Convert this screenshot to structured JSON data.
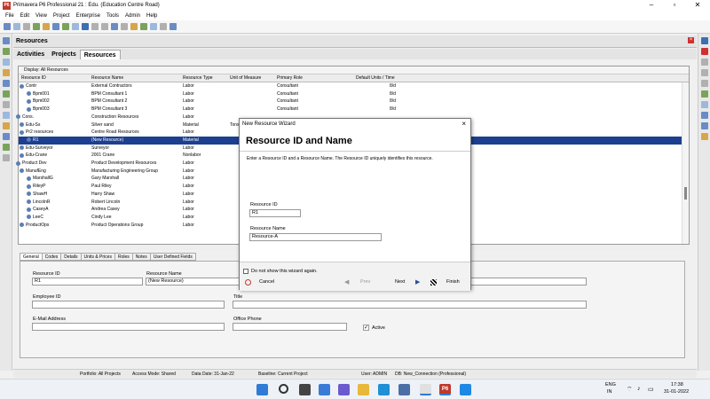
{
  "window": {
    "title": "Primavera P6 Professional 21 : Edu. (Education Centre Road)",
    "logo": "P6"
  },
  "menu": [
    "File",
    "Edit",
    "View",
    "Project",
    "Enterprise",
    "Tools",
    "Admin",
    "Help"
  ],
  "module": {
    "title": "Resources"
  },
  "tabs": [
    "Activities",
    "Projects",
    "Resources"
  ],
  "grid": {
    "display": "Display: All Resources",
    "columns": [
      "Resource ID",
      "Resource Name",
      "Resource Type",
      "Unit of Measure",
      "Primary Role",
      "Default Units / Time"
    ],
    "rows": [
      {
        "id": "Contr",
        "name": "External Contractors",
        "type": "Labor",
        "uom": "",
        "role": "Consultant",
        "units": "8/d"
      },
      {
        "id": "Bpm001",
        "name": "BPM Consultant 1",
        "type": "Labor",
        "uom": "",
        "role": "Consultant",
        "units": "8/d"
      },
      {
        "id": "Bpm002",
        "name": "BPM Consultant 2",
        "type": "Labor",
        "uom": "",
        "role": "Consultant",
        "units": "8/d"
      },
      {
        "id": "Bpm003",
        "name": "BPM Consultant 3",
        "type": "Labor",
        "uom": "",
        "role": "Consultant",
        "units": "8/d"
      },
      {
        "id": "Cons.",
        "name": "Construction Resources",
        "type": "Labor",
        "uom": "",
        "role": "",
        "units": ""
      },
      {
        "id": "Edu-Ss",
        "name": "Silver sand",
        "type": "Material",
        "uom": "Tons",
        "role": "",
        "units": ""
      },
      {
        "id": "Pr2 resources",
        "name": "Centre Road Resources",
        "type": "Labor",
        "uom": "",
        "role": "",
        "units": ""
      },
      {
        "id": "R1",
        "name": "(New Resource)",
        "type": "Material",
        "uom": "",
        "role": "",
        "units": ""
      },
      {
        "id": "Edu-Surveyor",
        "name": "Surveyor",
        "type": "Labor",
        "uom": "",
        "role": "",
        "units": ""
      },
      {
        "id": "Edu-Crane",
        "name": "2001 Crane",
        "type": "Nonlabor",
        "uom": "",
        "role": "",
        "units": ""
      },
      {
        "id": "Product Dev",
        "name": "Product Development Resources",
        "type": "Labor",
        "uom": "",
        "role": "",
        "units": ""
      },
      {
        "id": "ManufEng",
        "name": "Manufacturing Engineering Group",
        "type": "Labor",
        "uom": "",
        "role": "",
        "units": ""
      },
      {
        "id": "MarshallG",
        "name": "Gary Marshall",
        "type": "Labor",
        "uom": "",
        "role": "",
        "units": ""
      },
      {
        "id": "RileyP",
        "name": "Paul Riley",
        "type": "Labor",
        "uom": "",
        "role": "",
        "units": ""
      },
      {
        "id": "ShawH",
        "name": "Harry Shaw",
        "type": "Labor",
        "uom": "",
        "role": "",
        "units": ""
      },
      {
        "id": "LincolnR",
        "name": "Robert Lincoln",
        "type": "Labor",
        "uom": "",
        "role": "",
        "units": ""
      },
      {
        "id": "CaseyA",
        "name": "Andrea Casey",
        "type": "Labor",
        "uom": "",
        "role": "",
        "units": ""
      },
      {
        "id": "LeeC",
        "name": "Cindy Lee",
        "type": "Labor",
        "uom": "",
        "role": "",
        "units": ""
      },
      {
        "id": "ProductOps",
        "name": "Product Operations Group",
        "type": "Labor",
        "uom": "",
        "role": "",
        "units": ""
      }
    ]
  },
  "detail": {
    "tabs": [
      "General",
      "Codes",
      "Details",
      "Units & Prices",
      "Roles",
      "Notes",
      "User Defined Fields"
    ],
    "resource_id_label": "Resource ID",
    "resource_id": "R1",
    "resource_name_label": "Resource Name",
    "resource_name": "(New Resource)",
    "employee_id_label": "Employee ID",
    "title_label": "Title",
    "email_label": "E-Mail Address",
    "phone_label": "Office Phone",
    "active_label": "Active"
  },
  "dialog": {
    "title": "New Resource Wizard",
    "heading": "Resource ID and Name",
    "description": "Enter a Resource ID and a Resource Name. The Resource ID uniquely identifies this resource.",
    "id_label": "Resource ID",
    "id_value": "R1",
    "name_label": "Resource Name",
    "name_value": "Resource-A",
    "checkbox": "Do not show this wizard again.",
    "cancel": "Cancel",
    "prev": "Prev",
    "next": "Next",
    "finish": "Finish"
  },
  "status": {
    "portfolio": "Portfolio: All Projects",
    "access": "Access Mode: Shared",
    "datadate": "Data Date: 31-Jan-22",
    "baseline": "Baseline: Current Project",
    "user": "User: ADMIN",
    "db": "DB: New_Connection (Professional)"
  },
  "tray": {
    "lang1": "ENG",
    "lang2": "IN",
    "time": "17:38",
    "date": "31-01-2022"
  },
  "colors": {
    "selected": "#1c3f8f",
    "logo": "#c0392b"
  }
}
